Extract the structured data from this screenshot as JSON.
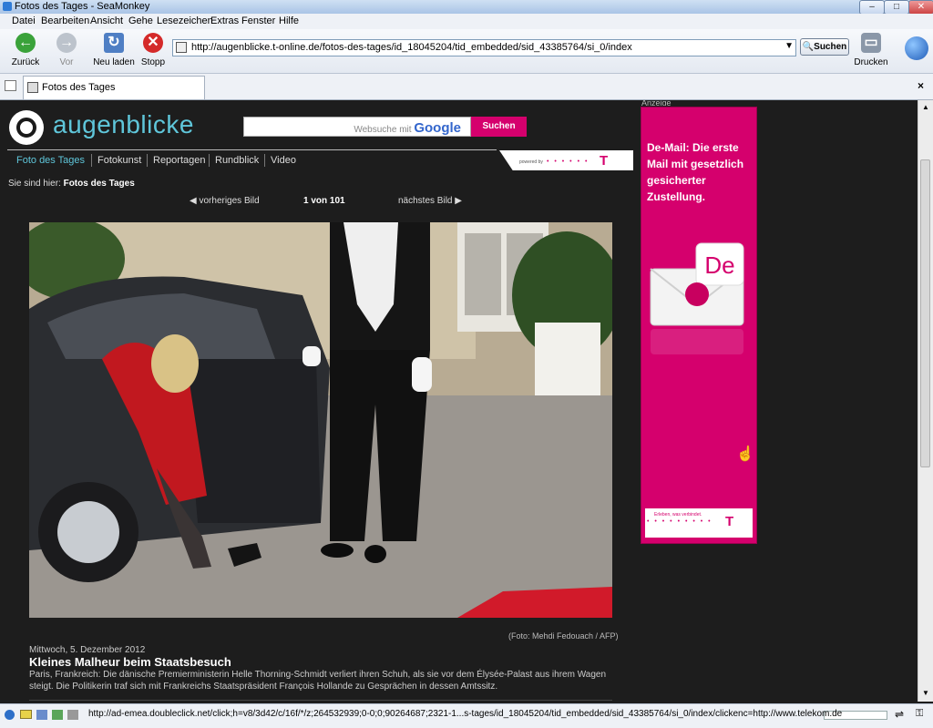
{
  "window": {
    "title": "Fotos des Tages - SeaMonkey"
  },
  "menubar": [
    "Datei",
    "Bearbeiten",
    "Ansicht",
    "Gehe",
    "Lesezeichen",
    "Extras",
    "Fenster",
    "Hilfe"
  ],
  "toolbar": {
    "back": "Zurück",
    "forward": "Vor",
    "reload": "Neu laden",
    "stop": "Stopp",
    "url": "http://augenblicke.t-online.de/fotos-des-tages/id_18045204/tid_embedded/sid_43385764/si_0/index",
    "search": "Suchen",
    "print": "Drucken"
  },
  "tabs": [
    {
      "label": "Fotos des Tages"
    }
  ],
  "site": {
    "logo": "augenblicke",
    "websearch_placeholder": "Websuche mit",
    "google": "Google",
    "search_button": "Suchen",
    "nav": [
      "Foto des Tages",
      "Fotokunst",
      "Reportagen",
      "Rundblick",
      "Video"
    ],
    "powered_by": "powered by",
    "breadcrumb_prefix": "Sie sind hier:",
    "breadcrumb_current": "Fotos des Tages",
    "prev": "vorheriges Bild",
    "count": "1 von 101",
    "next": "nächstes Bild",
    "credit": "(Foto: Mehdi Fedouach / AFP)",
    "date": "Mittwoch, 5. Dezember 2012",
    "headline": "Kleines Malheur beim Staatsbesuch",
    "body": "Paris, Frankreich: Die dänische Premierministerin Helle Thorning-Schmidt verliert ihren Schuh, als sie vor dem Élysée-Palast aus ihrem Wagen steigt. Die Politikerin traf sich mit Frankreichs Staatspräsident François Hollande zu Gesprächen in dessen Amtssitz."
  },
  "ad": {
    "label": "Anzeige",
    "text": "De-Mail: Die erste Mail mit gesetzlich gesicherter Zustellung.",
    "badge": "De",
    "slogan": "Erleben, was verbindet."
  },
  "status": {
    "url": "http://ad-emea.doubleclick.net/click;h=v8/3d42/c/16f/*/z;264532939;0-0;0;90264687;2321-1...s-tages/id_18045204/tid_embedded/sid_43385764/si_0/index/clickenc=http://www.telekom.de"
  },
  "colors": {
    "brand_magenta": "#d5006d",
    "logo_cyan": "#5fc6da"
  }
}
